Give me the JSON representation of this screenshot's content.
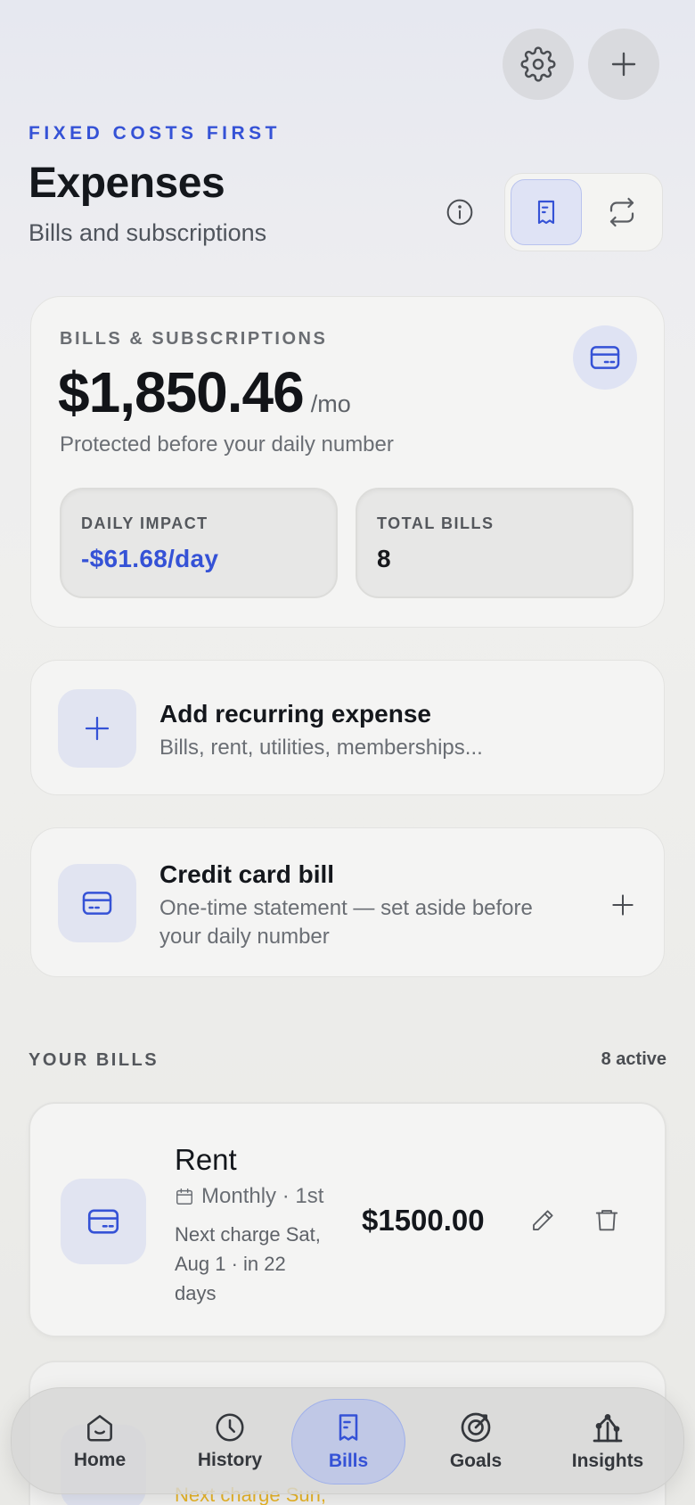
{
  "header": {
    "eyebrow": "FIXED COSTS FIRST",
    "title": "Expenses",
    "subtitle": "Bills and subscriptions",
    "view_toggle": [
      "receipt-icon",
      "repeat-icon"
    ]
  },
  "summary": {
    "label": "BILLS & SUBSCRIPTIONS",
    "amount": "$1,850.46",
    "period": "/mo",
    "note": "Protected before your daily number",
    "daily_impact_label": "DAILY IMPACT",
    "daily_impact_value": "-$61.68/day",
    "total_bills_label": "TOTAL BILLS",
    "total_bills_value": "8"
  },
  "add_recurring": {
    "title": "Add recurring expense",
    "subtitle": "Bills, rent, utilities, memberships..."
  },
  "credit_card": {
    "title": "Credit card bill",
    "subtitle_line1": "One-time statement — set aside before",
    "subtitle_line2": "your daily number"
  },
  "bills_section": {
    "heading": "YOUR BILLS",
    "count": "8 active",
    "bills": [
      {
        "name": "Rent",
        "schedule": "Monthly · 1st",
        "next_line1": "Next charge Sat,",
        "next_line2": "Aug 1 · in 22",
        "next_line3": "days",
        "amount": "$1500.00"
      },
      {
        "next_partial": "Next charge Sun,"
      }
    ]
  },
  "nav": {
    "items": [
      {
        "label": "Home",
        "icon": "home-icon"
      },
      {
        "label": "History",
        "icon": "clock-icon"
      },
      {
        "label": "Bills",
        "icon": "receipt-icon",
        "active": true
      },
      {
        "label": "Goals",
        "icon": "target-icon"
      },
      {
        "label": "Insights",
        "icon": "chart-icon"
      }
    ]
  },
  "colors": {
    "accent": "#3552d6",
    "tile": "#e1e4f1",
    "warning_text": "#e8b528"
  }
}
